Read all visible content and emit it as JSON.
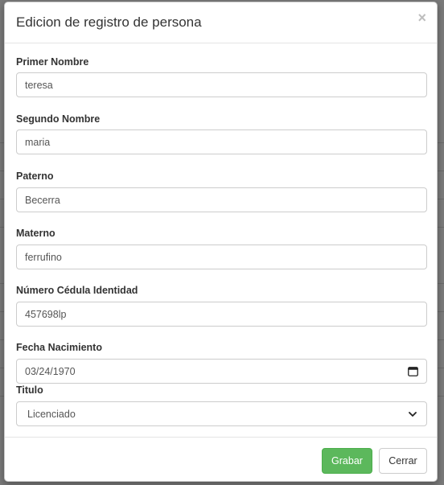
{
  "modal": {
    "title": "Edicion de registro de persona",
    "close_symbol": "×"
  },
  "form": {
    "fields": [
      {
        "label": "Primer Nombre",
        "value": "teresa"
      },
      {
        "label": "Segundo Nombre",
        "value": "maria"
      },
      {
        "label": "Paterno",
        "value": "Becerra"
      },
      {
        "label": "Materno",
        "value": "ferrufino"
      },
      {
        "label": "Número Cédula Identidad",
        "value": "457698lp"
      },
      {
        "label": "Fecha Nacimiento",
        "value": "03/24/1970",
        "icon": "calendar-icon"
      },
      {
        "label": "Titulo",
        "value": "Licenciado",
        "icon": "chevron-down-icon"
      }
    ]
  },
  "footer": {
    "save_label": "Grabar",
    "close_label": "Cerrar",
    "save_color": "#5cb85c"
  }
}
